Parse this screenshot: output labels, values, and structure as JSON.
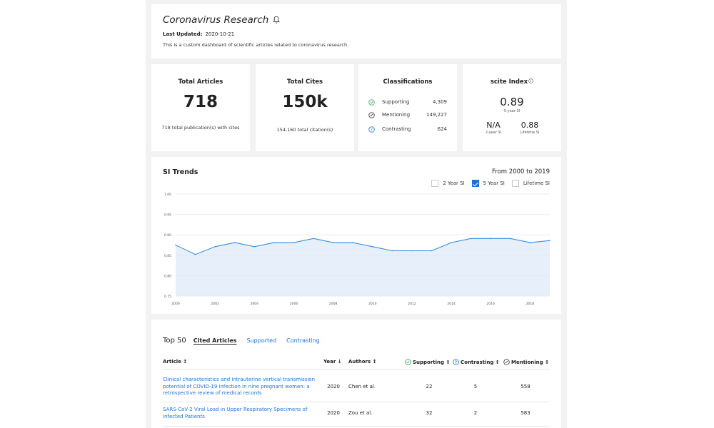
{
  "header": {
    "title": "Coronavirus Research",
    "updated_label": "Last Updated:",
    "updated_value": "2020-10-21",
    "description": "This is a custom dashboard of scientific articles related to coronavirus research.",
    "bell_icon": "bell-icon"
  },
  "stats": {
    "articles": {
      "label": "Total Articles",
      "value": "718",
      "sub": "718 total publication(s) with cites"
    },
    "cites": {
      "label": "Total Cites",
      "value": "150k",
      "sub": "154,160 total citation(s)"
    },
    "classifications": {
      "label": "Classifications",
      "rows": [
        {
          "label": "Supporting",
          "value": "4,309",
          "icon": "check-circle-icon",
          "color": "#2eaa5a"
        },
        {
          "label": "Mentioning",
          "value": "149,227",
          "icon": "dash-circle-icon",
          "color": "#333333"
        },
        {
          "label": "Contrasting",
          "value": "624",
          "icon": "question-circle-icon",
          "color": "#1a73d9"
        }
      ]
    },
    "scite": {
      "label": "scite Index",
      "info_icon": "info-icon",
      "five_year_value": "0.89",
      "five_year_label": "5-year SI",
      "two_year_value": "N/A",
      "two_year_label": "2-year SI",
      "lifetime_value": "0.88",
      "lifetime_label": "Lifetime SI"
    }
  },
  "trends": {
    "title": "SI Trends",
    "range": "From 2000 to 2019",
    "legend": [
      {
        "label": "2 Year SI",
        "checked": false
      },
      {
        "label": "5 Year SI",
        "checked": true
      },
      {
        "label": "Lifetime SI",
        "checked": false
      }
    ]
  },
  "chart_data": {
    "type": "area",
    "series": [
      {
        "x": [
          2000,
          2001,
          2002,
          2003,
          2004,
          2005,
          2006,
          2007,
          2008,
          2009,
          2010,
          2011,
          2012,
          2013,
          2014,
          2015,
          2016,
          2017,
          2018,
          2019
        ],
        "values": [
          0.875,
          0.852,
          0.871,
          0.881,
          0.871,
          0.881,
          0.881,
          0.891,
          0.881,
          0.881,
          0.871,
          0.861,
          0.861,
          0.861,
          0.881,
          0.891,
          0.891,
          0.891,
          0.881,
          0.886
        ]
      }
    ],
    "ylim": [
      0.75,
      1.0
    ],
    "yticks": [
      "0.75",
      "0.80",
      "0.85",
      "0.90",
      "0.95",
      "1.00"
    ],
    "xticks": [
      "2000",
      "2002",
      "2004",
      "2006",
      "2008",
      "2010",
      "2012",
      "2014",
      "2016",
      "2018"
    ],
    "xlim": [
      2000,
      2019
    ],
    "grid": true,
    "colors": {
      "line": "#3a8ee0",
      "fill": "#dbe8f8"
    }
  },
  "table": {
    "top_label": "Top 50",
    "tabs": [
      {
        "label": "Cited Articles",
        "active": true
      },
      {
        "label": "Supported",
        "active": false
      },
      {
        "label": "Contrasting",
        "active": false
      }
    ],
    "headers": {
      "article": "Article ↕",
      "year": "Year ↓",
      "authors": "Authors ↕",
      "supporting": "Supporting ↕",
      "contrasting": "Contrasting ↕",
      "mentioning": "Mentioning ↕"
    },
    "rows": [
      {
        "title": "Clinical characteristics and intrauterine vertical transmission potential of COVID-19 infection in nine pregnant women: a retrospective review of medical records",
        "year": "2020",
        "authors": "Chen et al.",
        "supporting": "22",
        "contrasting": "5",
        "mentioning": "558"
      },
      {
        "title": "SARS-CoV-2 Viral Load in Upper Respiratory Specimens of Infected Patients",
        "year": "2020",
        "authors": "Zou et al.",
        "supporting": "32",
        "contrasting": "2",
        "mentioning": "583"
      }
    ]
  }
}
